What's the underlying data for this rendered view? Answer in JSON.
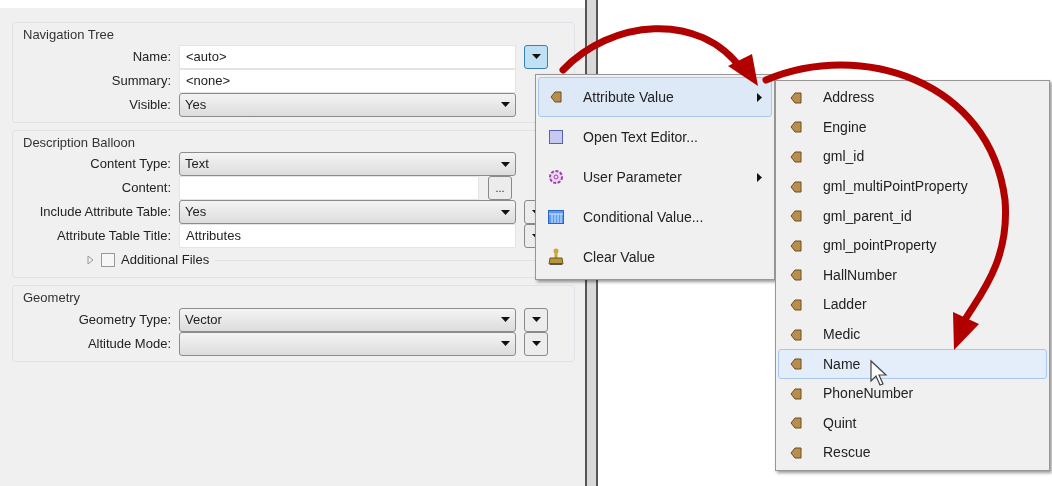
{
  "groups": [
    {
      "title": "Navigation Tree",
      "rows": [
        {
          "kind": "text",
          "label": "Name:",
          "value": "<auto>",
          "button_active": true
        },
        {
          "kind": "text",
          "label": "Summary:",
          "value": "<none>"
        },
        {
          "kind": "select",
          "label": "Visible:",
          "value": "Yes"
        }
      ]
    },
    {
      "title": "Description Balloon",
      "rows": [
        {
          "kind": "select",
          "label": "Content Type:",
          "value": "Text"
        },
        {
          "kind": "browse",
          "label": "Content:",
          "value": "",
          "browse_label": "..."
        },
        {
          "kind": "select",
          "label": "Include Attribute Table:",
          "value": "Yes",
          "button_active": false
        },
        {
          "kind": "text",
          "label": "Attribute Table Title:",
          "value": "Attributes",
          "button_active": false
        },
        {
          "kind": "expander",
          "label": "Additional Files",
          "checked": false,
          "expanded": false
        }
      ]
    },
    {
      "title": "Geometry",
      "rows": [
        {
          "kind": "select",
          "label": "Geometry Type:",
          "value": "Vector",
          "button_active": false
        },
        {
          "kind": "select",
          "label": "Altitude Mode:",
          "value": "",
          "button_active": false
        }
      ]
    }
  ],
  "menu": {
    "items": [
      {
        "kind": "attribute",
        "label": "Attribute Value",
        "submenu": true,
        "selected": true
      },
      {
        "kind": "editor",
        "label": "Open Text Editor...",
        "submenu": false,
        "selected": false
      },
      {
        "kind": "parameter",
        "label": "User Parameter",
        "submenu": true,
        "selected": false
      },
      {
        "kind": "conditional",
        "label": "Conditional Value...",
        "submenu": false,
        "selected": false
      },
      {
        "kind": "clear",
        "label": "Clear Value",
        "submenu": false,
        "selected": false
      }
    ]
  },
  "submenu": {
    "items": [
      {
        "label": "Address",
        "selected": false
      },
      {
        "label": "Engine",
        "selected": false
      },
      {
        "label": "gml_id",
        "selected": false
      },
      {
        "label": "gml_multiPointProperty",
        "selected": false
      },
      {
        "label": "gml_parent_id",
        "selected": false
      },
      {
        "label": "gml_pointProperty",
        "selected": false
      },
      {
        "label": "HallNumber",
        "selected": false
      },
      {
        "label": "Ladder",
        "selected": false
      },
      {
        "label": "Medic",
        "selected": false
      },
      {
        "label": "Name",
        "selected": true
      },
      {
        "label": "PhoneNumber",
        "selected": false
      },
      {
        "label": "Quint",
        "selected": false
      },
      {
        "label": "Rescue",
        "selected": false
      }
    ]
  }
}
